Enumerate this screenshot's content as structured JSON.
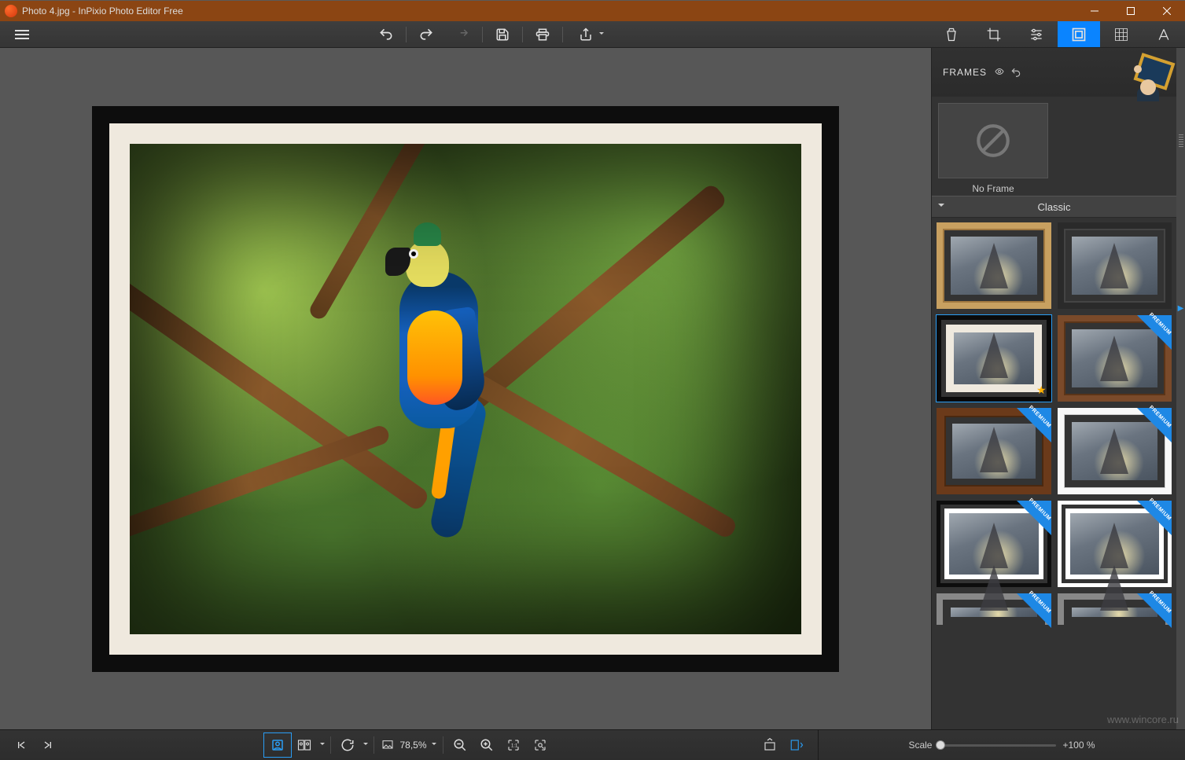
{
  "titlebar": {
    "title": "Photo 4.jpg - InPixio Photo Editor Free"
  },
  "panel": {
    "title": "FRAMES",
    "no_frame_label": "No Frame",
    "category": "Classic",
    "premium_label": "PREMIUM"
  },
  "bottombar": {
    "zoom_percent": "78,5%",
    "scale_label": "Scale",
    "scale_value": "+100 %"
  },
  "watermark": "www.wincore.ru"
}
